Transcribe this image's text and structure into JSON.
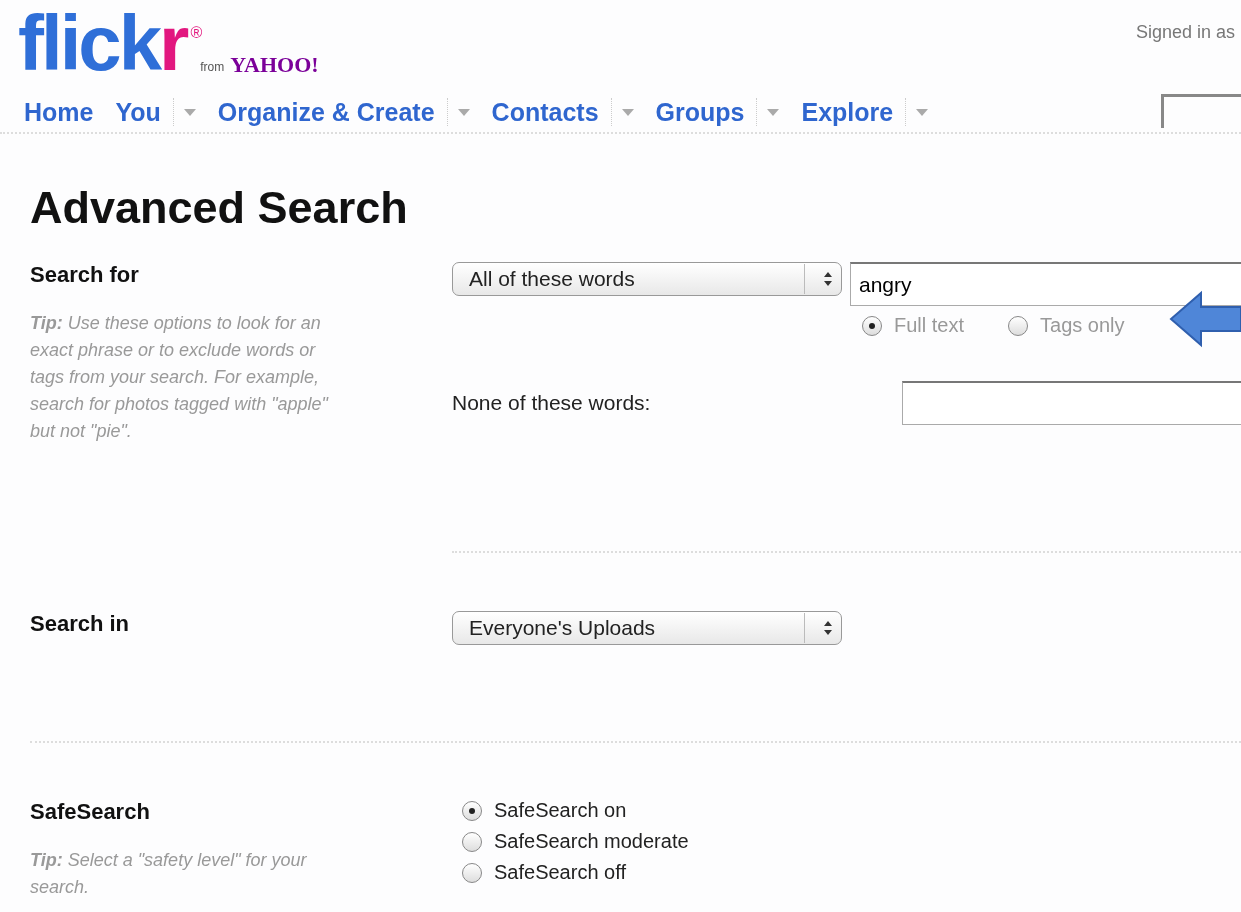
{
  "logo": {
    "main": "flick",
    "accent": "r",
    "mark": "®",
    "from": "from",
    "partner": "YAHOO!"
  },
  "signed_in": "Signed in as",
  "nav": [
    {
      "label": "Home",
      "menu": false
    },
    {
      "label": "You",
      "menu": true
    },
    {
      "label": "Organize & Create",
      "menu": true
    },
    {
      "label": "Contacts",
      "menu": true
    },
    {
      "label": "Groups",
      "menu": true
    },
    {
      "label": "Explore",
      "menu": true
    }
  ],
  "title": "Advanced Search",
  "sections": [
    {
      "label": "Search for",
      "tip": "**Tip:** Use these options to look for an exact phrase or to exclude words or tags from your search. For example, search for photos tagged with \"apple\" but not \"pie\".",
      "select": "All of these words",
      "query": "angry",
      "scope": [
        {
          "label": "Full text",
          "selected": true
        },
        {
          "label": "Tags only",
          "selected": false
        }
      ],
      "exclude_label": "None of these words:"
    },
    {
      "label": "Search in",
      "select": "Everyone's Uploads"
    },
    {
      "label": "SafeSearch",
      "tip": "**Tip:** Select a \"safety level\" for your search.",
      "options": [
        {
          "label": "SafeSearch on",
          "selected": true
        },
        {
          "label": "SafeSearch moderate",
          "selected": false
        },
        {
          "label": "SafeSearch off",
          "selected": false
        }
      ]
    }
  ]
}
